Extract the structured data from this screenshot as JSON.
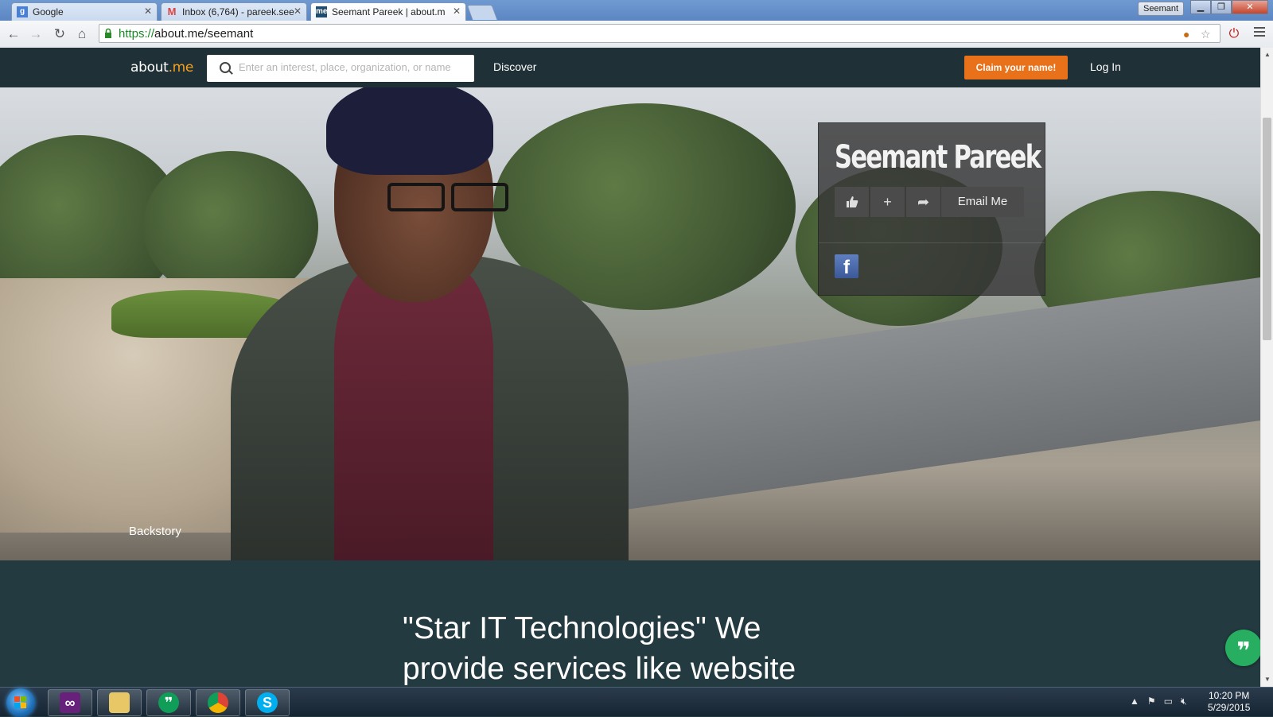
{
  "browser": {
    "tabs": [
      {
        "title": "Google",
        "favicon": "google-favicon"
      },
      {
        "title": "Inbox (6,764) - pareek.see",
        "favicon": "gmail-favicon"
      },
      {
        "title": "Seemant Pareek | about.m",
        "favicon": "aboutme-favicon",
        "favicon_text": "me",
        "active": true
      }
    ],
    "user": "Seemant",
    "url_scheme": "https://",
    "url_rest": "about.me/seemant"
  },
  "site": {
    "logo_main": "about",
    "logo_accent": ".me",
    "search_placeholder": "Enter an interest, place, organization, or name",
    "discover": "Discover",
    "claim": "Claim your name!",
    "login": "Log In",
    "accent_color": "#e8711a"
  },
  "profile": {
    "name": "Seemant Pareek",
    "email_label": "Email Me",
    "backstory": "Backstory",
    "facebook_glyph": "f",
    "bio": "\"Star IT Technologies\" We provide services like website"
  },
  "taskbar": {
    "time": "10:20 PM",
    "date": "5/29/2015",
    "apps": [
      "visual-studio-icon",
      "file-explorer-icon",
      "hangouts-icon",
      "chrome-icon",
      "skype-icon"
    ]
  }
}
